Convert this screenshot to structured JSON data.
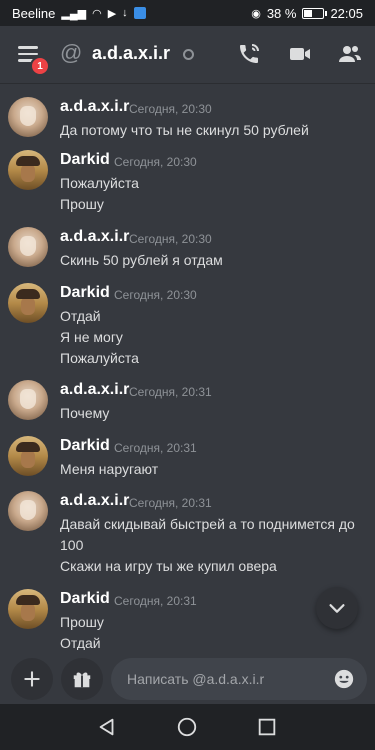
{
  "status_bar": {
    "carrier": "Beeline",
    "battery": "38 %",
    "time": "22:05"
  },
  "header": {
    "title": "a.d.a.x.i.r",
    "notification_count": "1"
  },
  "messages": [
    {
      "author": "a.d.a.x.i.r",
      "timestamp": "Сегодня, 20:30",
      "avatar": "axir",
      "lines": [
        "Да потому что ты не скинул 50 рублей"
      ]
    },
    {
      "author": "Darkid",
      "timestamp": "Сегодня, 20:30",
      "avatar": "darkid",
      "lines": [
        "Пожалуйста",
        "Прошу"
      ]
    },
    {
      "author": "a.d.a.x.i.r",
      "timestamp": "Сегодня, 20:30",
      "avatar": "axir",
      "lines": [
        "Скинь 50 рублей я отдам"
      ]
    },
    {
      "author": "Darkid",
      "timestamp": "Сегодня, 20:30",
      "avatar": "darkid",
      "lines": [
        "Отдай",
        "Я не могу",
        "Пожалуйста"
      ]
    },
    {
      "author": "a.d.a.x.i.r",
      "timestamp": "Сегодня, 20:31",
      "avatar": "axir",
      "lines": [
        "Почему"
      ]
    },
    {
      "author": "Darkid",
      "timestamp": "Сегодня, 20:31",
      "avatar": "darkid",
      "lines": [
        "Меня наругают"
      ]
    },
    {
      "author": "a.d.a.x.i.r",
      "timestamp": "Сегодня, 20:31",
      "avatar": "axir",
      "lines": [
        "Давай скидывай быстрей а то поднимется до",
        "100",
        "Скажи на игру ты же купил овера"
      ]
    },
    {
      "author": "Darkid",
      "timestamp": "Сегодня, 20:31",
      "avatar": "darkid",
      "lines": [
        "Прошу",
        "Отдай"
      ]
    }
  ],
  "composer": {
    "placeholder": "Написать @a.d.a.x.i.r"
  },
  "icons": {
    "menu": "hamburger-icon",
    "call": "phone-call-icon",
    "video": "video-camera-icon",
    "members": "members-icon",
    "scroll": "chevron-down-icon",
    "add": "plus-icon",
    "gift": "gift-icon",
    "emoji": "emoji-icon"
  },
  "colors": {
    "background": "#36393f",
    "badge": "#ed4245",
    "navbar": "#202225"
  }
}
